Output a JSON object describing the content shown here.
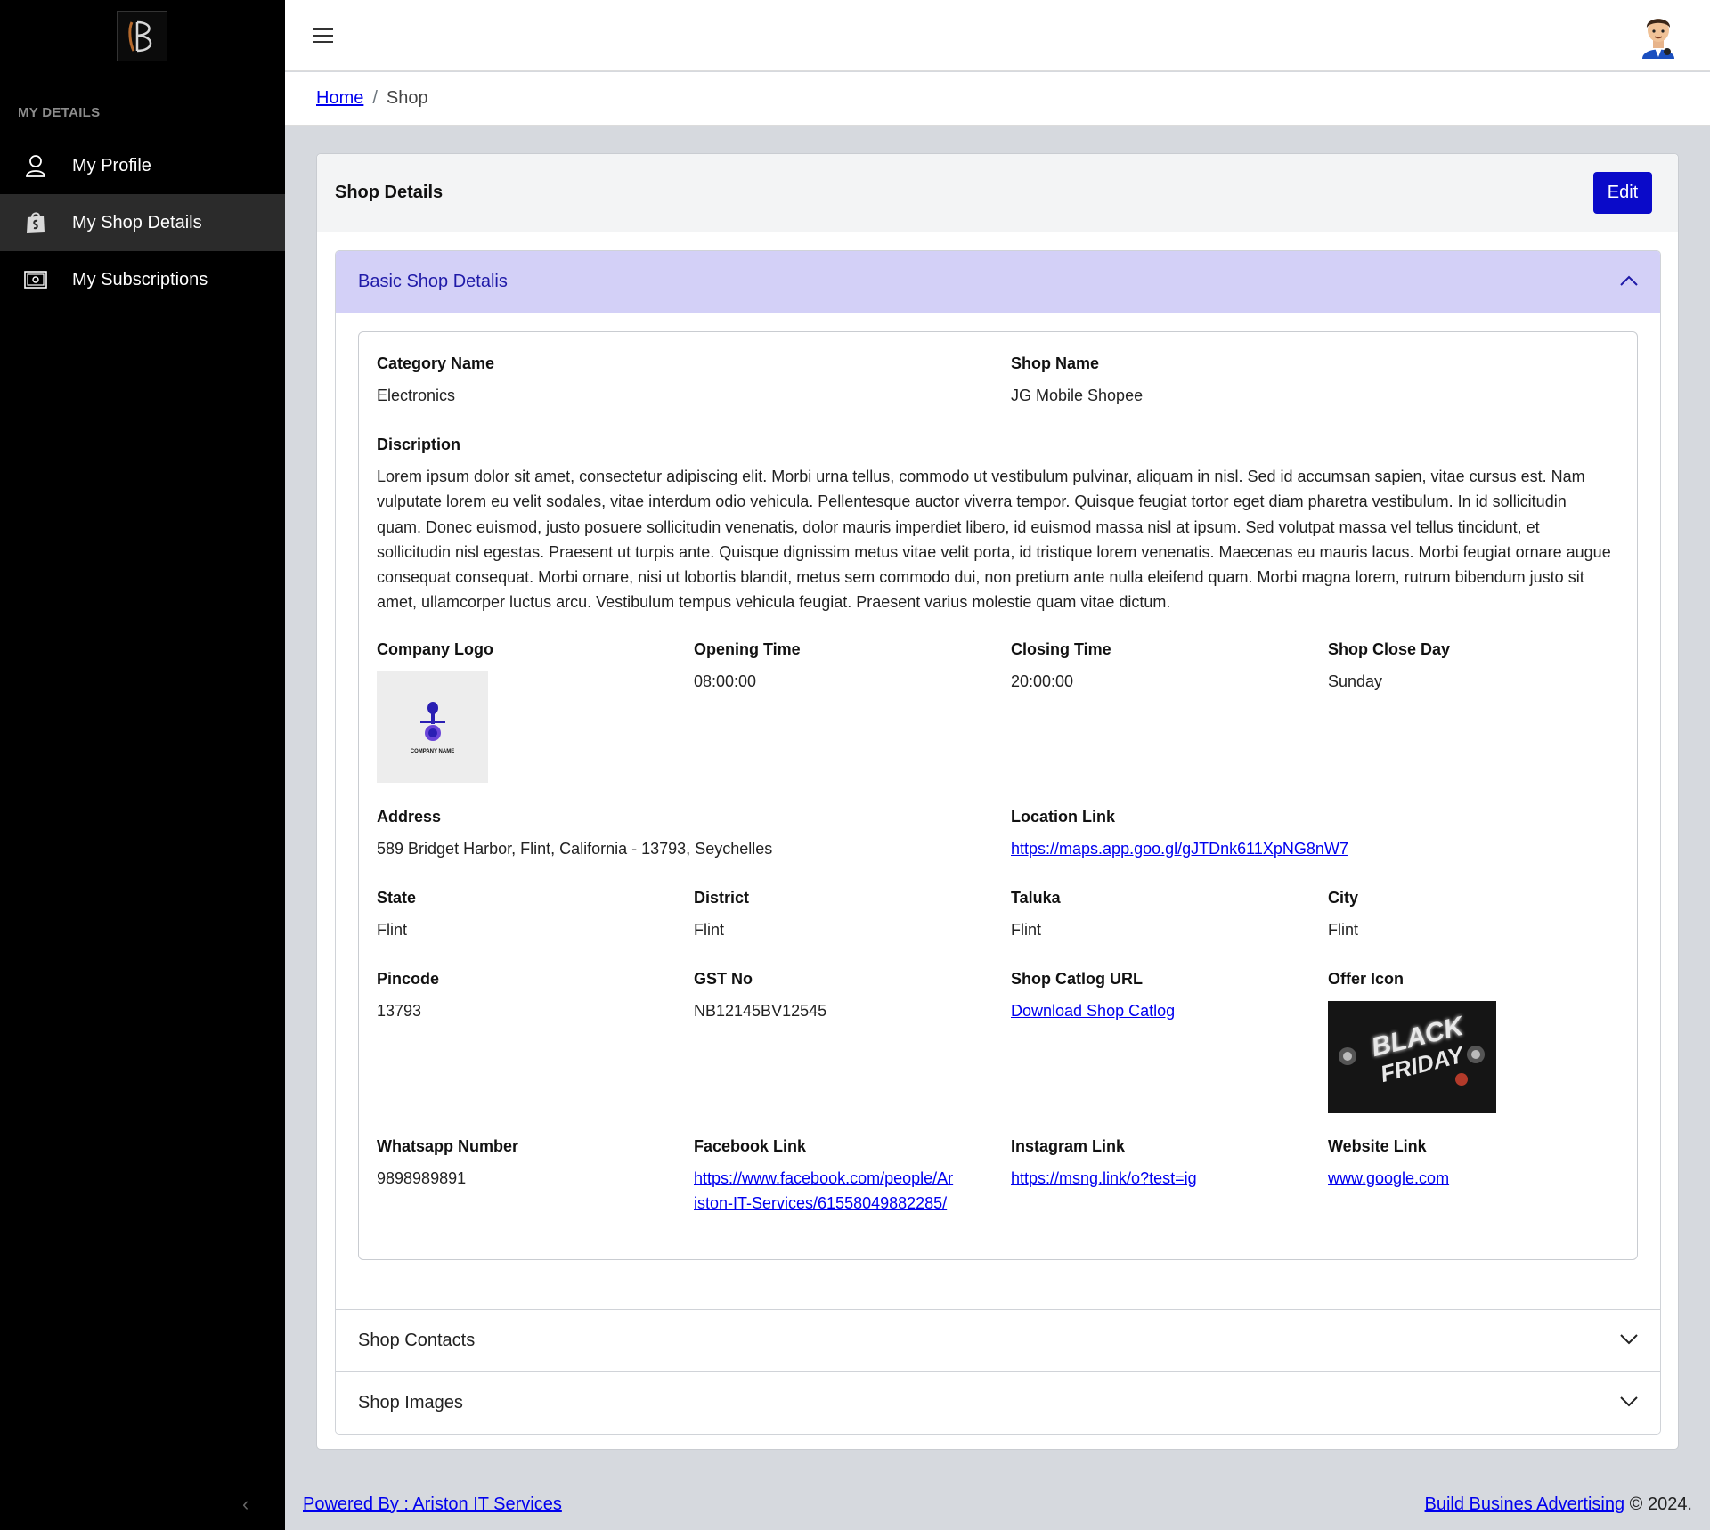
{
  "sidebar": {
    "section_title": "MY DETAILS",
    "items": [
      {
        "label": "My Profile",
        "icon": "user-icon",
        "active": false
      },
      {
        "label": "My Shop Details",
        "icon": "shop-bag-icon",
        "active": true
      },
      {
        "label": "My Subscriptions",
        "icon": "money-icon",
        "active": false
      }
    ]
  },
  "breadcrumb": {
    "home": "Home",
    "current": "Shop"
  },
  "card": {
    "title": "Shop Details",
    "edit_label": "Edit"
  },
  "accordion": {
    "basic": "Basic Shop Detalis",
    "contacts": "Shop Contacts",
    "images": "Shop Images"
  },
  "details": {
    "category_label": "Category Name",
    "category": "Electronics",
    "shop_name_label": "Shop Name",
    "shop_name": "JG Mobile Shopee",
    "description_label": "Discription",
    "description": "Lorem ipsum dolor sit amet, consectetur adipiscing elit. Morbi urna tellus, commodo ut vestibulum pulvinar, aliquam in nisl. Sed id accumsan sapien, vitae cursus est. Nam vulputate lorem eu velit sodales, vitae interdum odio vehicula. Pellentesque auctor viverra tempor. Quisque feugiat tortor eget diam pharetra vestibulum. In id sollicitudin quam. Donec euismod, justo posuere sollicitudin venenatis, dolor mauris imperdiet libero, id euismod massa nisl at ipsum. Sed volutpat massa vel tellus tincidunt, et sollicitudin nisl egestas. Praesent ut turpis ante. Quisque dignissim metus vitae velit porta, id tristique lorem venenatis. Maecenas eu mauris lacus. Morbi feugiat ornare augue consequat consequat. Morbi ornare, nisi ut lobortis blandit, metus sem commodo dui, non pretium ante nulla eleifend quam. Morbi magna lorem, rutrum bibendum justo sit amet, ullamcorper luctus arcu. Vestibulum tempus vehicula feugiat. Praesent varius molestie quam vitae dictum.",
    "company_logo_label": "Company Logo",
    "company_logo_text": "COMPANY NAME",
    "opening_label": "Opening Time",
    "opening": "08:00:00",
    "closing_label": "Closing Time",
    "closing": "20:00:00",
    "close_day_label": "Shop Close Day",
    "close_day": "Sunday",
    "address_label": "Address",
    "address": "589 Bridget Harbor, Flint, California - 13793, Seychelles",
    "location_label": "Location Link",
    "location": "https://maps.app.goo.gl/gJTDnk611XpNG8nW7",
    "state_label": "State",
    "state": "Flint",
    "district_label": "District",
    "district": "Flint",
    "taluka_label": "Taluka",
    "taluka": "Flint",
    "city_label": "City",
    "city": "Flint",
    "pincode_label": "Pincode",
    "pincode": "13793",
    "gst_label": "GST No",
    "gst": "NB12145BV12545",
    "catalog_label": "Shop Catlog URL",
    "catalog": "Download Shop Catlog",
    "offer_label": "Offer Icon",
    "offer_text_1": "BLACK",
    "offer_text_2": "FRIDAY",
    "whatsapp_label": "Whatsapp Number",
    "whatsapp": "9898989891",
    "facebook_label": "Facebook Link",
    "facebook_line1": "https://www.facebook.com/people/Ar",
    "facebook_line2": "iston-IT-Services/61558049882285/",
    "instagram_label": "Instagram Link",
    "instagram": "https://msng.link/o?test=ig",
    "website_label": "Website Link",
    "website": "www.google.com"
  },
  "footer": {
    "powered": "Powered By : Ariston IT Services",
    "brand": "Build Busines Advertising",
    "copyright": " © 2024."
  },
  "colors": {
    "accent": "#0a0ac9",
    "accordion_open_bg": "#d3d0f7",
    "sidebar_bg": "#000000",
    "page_bg": "#d6d9de"
  }
}
